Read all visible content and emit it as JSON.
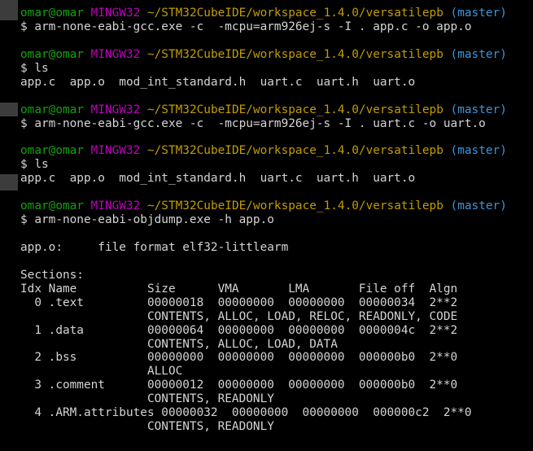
{
  "blocks": [
    {
      "prompt": {
        "user": "omar@omar",
        "host": "MINGW32",
        "path": "~/STM32CubeIDE/workspace_1.4.0/versatilepb",
        "branch": "(master)"
      },
      "command": "$ arm-none-eabi-gcc.exe -c  -mcpu=arm926ej-s -I . app.c -o app.o",
      "output": []
    },
    {
      "prompt": {
        "user": "omar@omar",
        "host": "MINGW32",
        "path": "~/STM32CubeIDE/workspace_1.4.0/versatilepb",
        "branch": "(master)"
      },
      "command": "$ ls",
      "output": [
        "app.c  app.o  mod_int_standard.h  uart.c  uart.h  uart.o"
      ]
    },
    {
      "prompt": {
        "user": "omar@omar",
        "host": "MINGW32",
        "path": "~/STM32CubeIDE/workspace_1.4.0/versatilepb",
        "branch": "(master)"
      },
      "command": "$ arm-none-eabi-gcc.exe -c  -mcpu=arm926ej-s -I . uart.c -o uart.o",
      "output": []
    },
    {
      "prompt": {
        "user": "omar@omar",
        "host": "MINGW32",
        "path": "~/STM32CubeIDE/workspace_1.4.0/versatilepb",
        "branch": "(master)"
      },
      "command": "$ ls",
      "output": [
        "app.c  app.o  mod_int_standard.h  uart.c  uart.h  uart.o"
      ]
    },
    {
      "prompt": {
        "user": "omar@omar",
        "host": "MINGW32",
        "path": "~/STM32CubeIDE/workspace_1.4.0/versatilepb",
        "branch": "(master)"
      },
      "command": "$ arm-none-eabi-objdump.exe -h app.o",
      "output": [
        "",
        "app.o:     file format elf32-littlearm",
        "",
        "Sections:",
        "Idx Name          Size      VMA       LMA       File off  Algn",
        "  0 .text         00000018  00000000  00000000  00000034  2**2",
        "                  CONTENTS, ALLOC, LOAD, RELOC, READONLY, CODE",
        "  1 .data         00000064  00000000  00000000  0000004c  2**2",
        "                  CONTENTS, ALLOC, LOAD, DATA",
        "  2 .bss          00000000  00000000  00000000  000000b0  2**0",
        "                  ALLOC",
        "  3 .comment      00000012  00000000  00000000  000000b0  2**0",
        "                  CONTENTS, READONLY",
        "  4 .ARM.attributes 00000032  00000000  00000000  000000c2  2**0",
        "                  CONTENTS, READONLY"
      ]
    }
  ],
  "colors": {
    "background": "#000000",
    "text": "#d4d4d4",
    "user": "#13a10e",
    "host": "#c100c1",
    "path": "#c19c00",
    "branch": "#3a96dd"
  }
}
